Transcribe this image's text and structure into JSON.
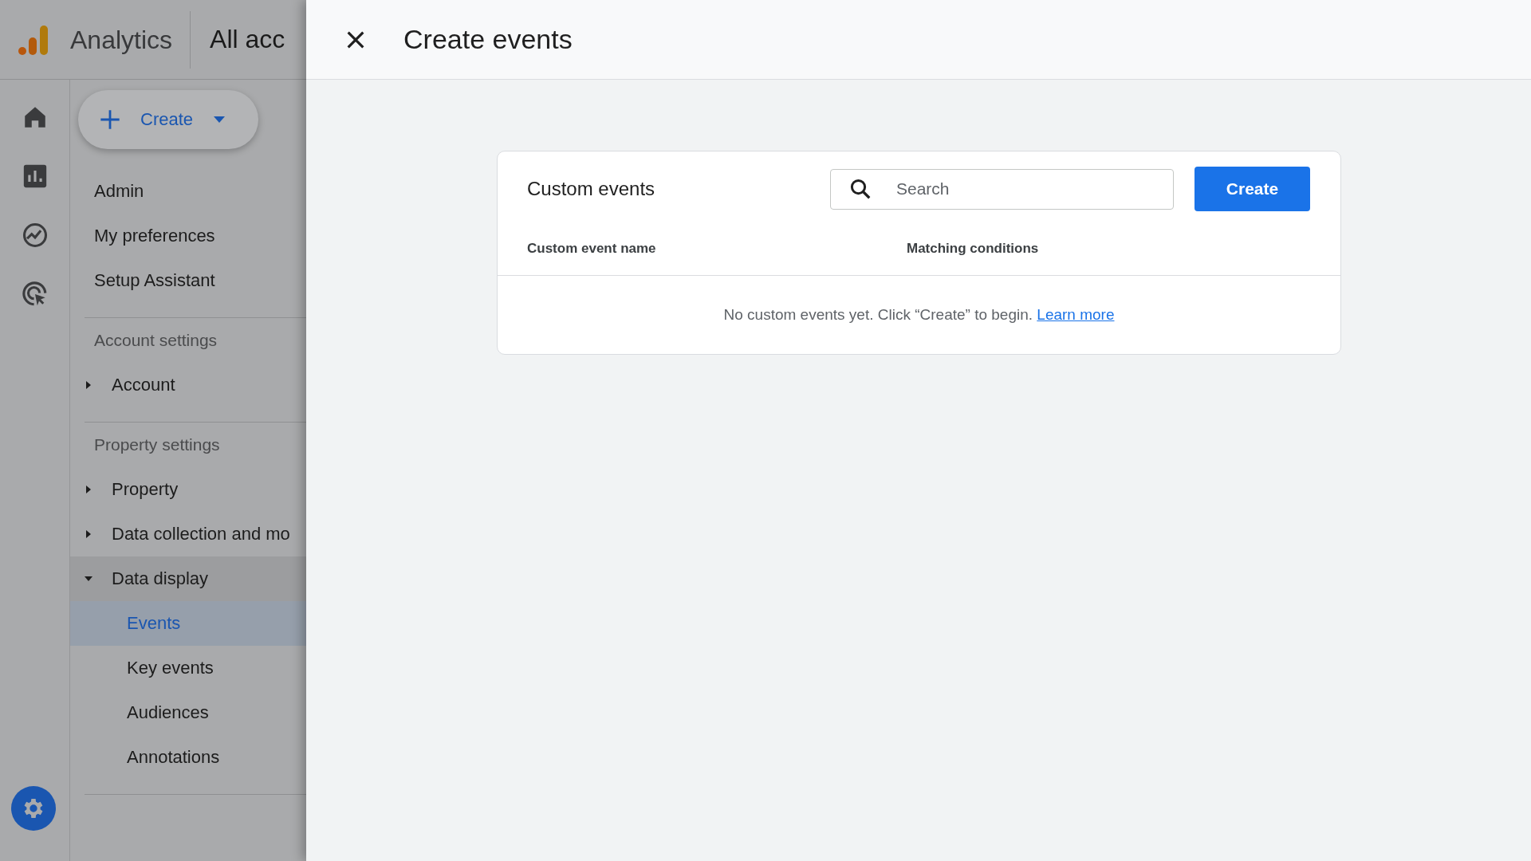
{
  "app_header": {
    "product": "Analytics",
    "account_picker": "All acc"
  },
  "sidebar": {
    "create_button": "Create",
    "items": [
      {
        "label": "Admin"
      },
      {
        "label": "My preferences"
      },
      {
        "label": "Setup Assistant"
      }
    ],
    "sections": [
      {
        "title": "Account settings",
        "items": [
          {
            "label": "Account",
            "expanded": false
          }
        ]
      },
      {
        "title": "Property settings",
        "items": [
          {
            "label": "Property",
            "expanded": false
          },
          {
            "label": "Data collection and mo",
            "expanded": false
          },
          {
            "label": "Data display",
            "expanded": true,
            "children": [
              {
                "label": "Events",
                "selected": true
              },
              {
                "label": "Key events",
                "selected": false
              },
              {
                "label": "Audiences",
                "selected": false
              },
              {
                "label": "Annotations",
                "selected": false
              }
            ]
          }
        ]
      }
    ]
  },
  "panel": {
    "title": "Create events",
    "card": {
      "title": "Custom events",
      "search": {
        "placeholder": "Search"
      },
      "create_button": "Create",
      "columns": [
        "Custom event name",
        "Matching conditions"
      ],
      "empty_message": "No custom events yet. Click “Create” to begin.",
      "link": "Learn more"
    }
  }
}
